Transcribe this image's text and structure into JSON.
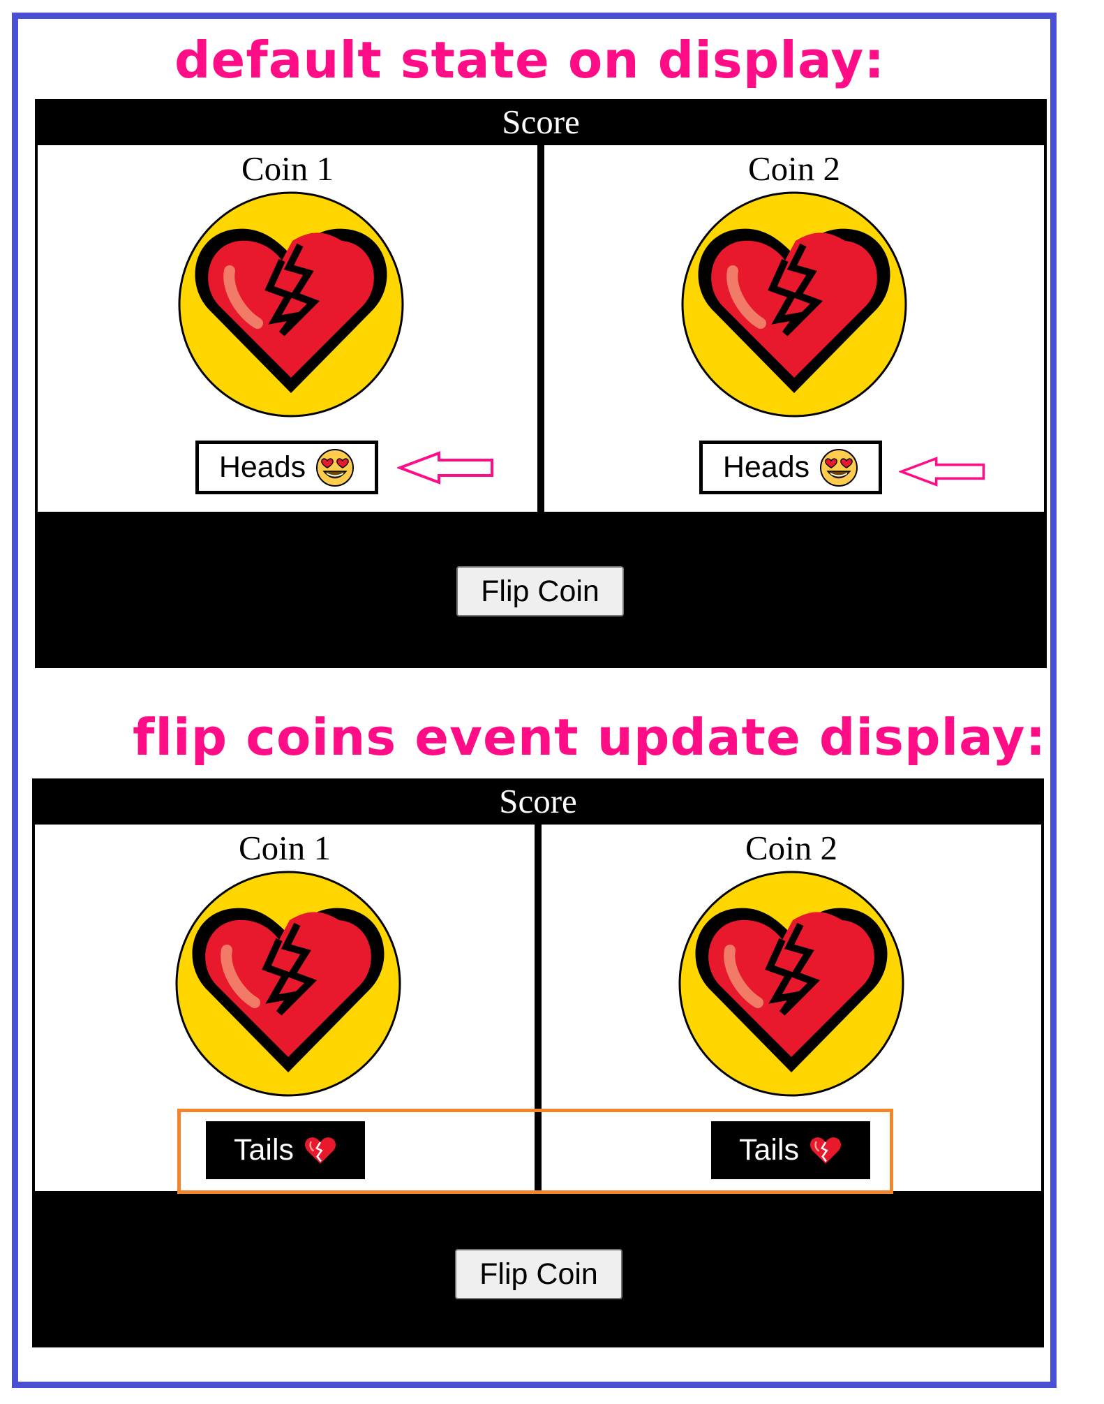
{
  "annotations": {
    "default_heading": "default state on display:",
    "updated_heading": "flip coins event update display:",
    "annotation_color": "#ff0d86",
    "highlight_color": "#f2852c",
    "frame_color": "#4a50d6",
    "arrow_icon": "left-arrow-icon"
  },
  "default_state": {
    "title": "Score",
    "coins": [
      {
        "label": "Coin 1",
        "face_icon": "broken-heart-icon",
        "result": "Heads",
        "result_emoji": "heart-eyes-emoji-icon"
      },
      {
        "label": "Coin 2",
        "face_icon": "broken-heart-icon",
        "result": "Heads",
        "result_emoji": "heart-eyes-emoji-icon"
      }
    ],
    "button_label": "Flip Coin"
  },
  "updated_state": {
    "title": "Score",
    "coins": [
      {
        "label": "Coin 1",
        "face_icon": "broken-heart-icon",
        "result": "Tails",
        "result_emoji": "broken-heart-icon"
      },
      {
        "label": "Coin 2",
        "face_icon": "broken-heart-icon",
        "result": "Tails",
        "result_emoji": "broken-heart-icon"
      }
    ],
    "button_label": "Flip Coin"
  },
  "colors": {
    "coin_gold": "#ffd600",
    "heart_red": "#e8192c",
    "panel_black": "#000000"
  }
}
